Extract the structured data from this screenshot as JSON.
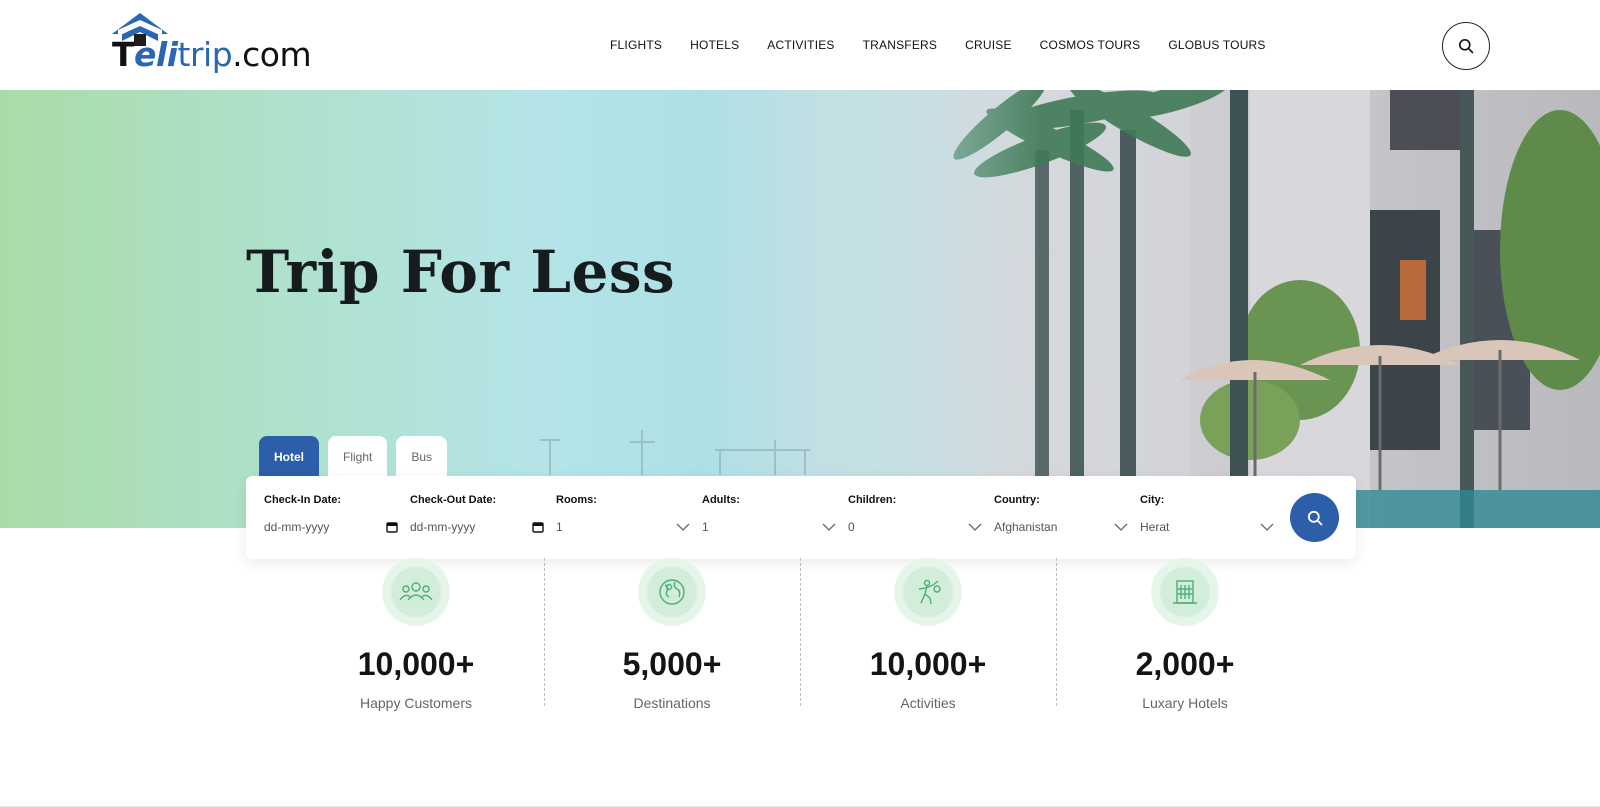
{
  "brand": {
    "logo_part1": "T",
    "logo_part2": "eli",
    "logo_part3": "trip",
    "logo_part4": ".com",
    "primary_color": "#2d5ea9",
    "accent_color": "#2a66b3"
  },
  "nav": {
    "items": [
      "FLIGHTS",
      "HOTELS",
      "ACTIVITIES",
      "TRANSFERS",
      "CRUISE",
      "COSMOS TOURS",
      "GLOBUS TOURS"
    ],
    "search_icon": "search-icon"
  },
  "hero": {
    "title": "Trip For Less"
  },
  "booking": {
    "tabs": [
      {
        "label": "Hotel",
        "active": true
      },
      {
        "label": "Flight",
        "active": false
      },
      {
        "label": "Bus",
        "active": false
      }
    ],
    "fields": [
      {
        "label": "Check-In Date:",
        "value": "dd-mm-yyyy",
        "icon": "calendar-icon"
      },
      {
        "label": "Check-Out Date:",
        "value": "dd-mm-yyyy",
        "icon": "calendar-icon"
      },
      {
        "label": "Rooms:",
        "value": "1",
        "icon": "chevron-down-icon"
      },
      {
        "label": "Adults:",
        "value": "1",
        "icon": "chevron-down-icon"
      },
      {
        "label": "Children:",
        "value": "0",
        "icon": "chevron-down-icon"
      },
      {
        "label": "Country:",
        "value": "Afghanistan",
        "icon": "chevron-down-icon"
      },
      {
        "label": "City:",
        "value": "Herat",
        "icon": "chevron-down-icon"
      }
    ],
    "search_button_icon": "search-icon"
  },
  "stats": [
    {
      "number": "10,000+",
      "caption": "Happy Customers",
      "icon": "people-icon"
    },
    {
      "number": "5,000+",
      "caption": "Destinations",
      "icon": "globe-icon"
    },
    {
      "number": "10,000+",
      "caption": "Activities",
      "icon": "activity-icon"
    },
    {
      "number": "2,000+",
      "caption": "Luxary Hotels",
      "icon": "hotel-icon"
    }
  ]
}
